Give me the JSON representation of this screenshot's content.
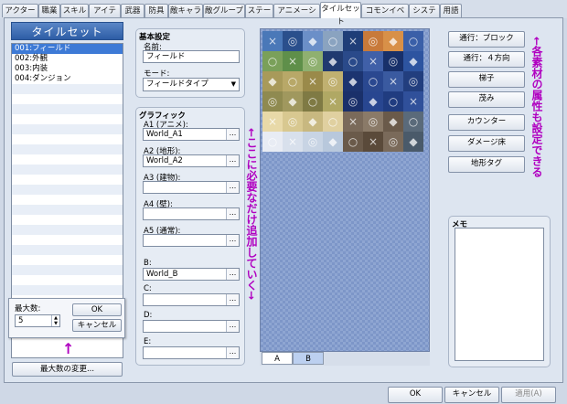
{
  "tabs": [
    "アクター",
    "職業",
    "スキル",
    "アイテム",
    "武器",
    "防具",
    "敵キャラ",
    "敵グループ",
    "ステート",
    "アニメーション",
    "タイルセット",
    "コモンイベント",
    "システム",
    "用語"
  ],
  "active_tab": "タイルセット",
  "tileset_panel": {
    "title": "タイルセット",
    "items": [
      "001:フィールド",
      "002:外観",
      "003:内装",
      "004:ダンジョン"
    ],
    "change_max_button": "最大数の変更..."
  },
  "max_popup": {
    "label": "最大数:",
    "value": "5",
    "ok": "OK",
    "cancel": "キャンセル"
  },
  "basic": {
    "group_label": "基本設定",
    "name_label": "名前:",
    "name_value": "フィールド",
    "mode_label": "モード:",
    "mode_value": "フィールドタイプ"
  },
  "graphics": {
    "group_label": "グラフィック",
    "slots": [
      {
        "label": "A1 (アニメ):",
        "value": "World_A1"
      },
      {
        "label": "A2 (地形):",
        "value": "World_A2"
      },
      {
        "label": "A3 (建物):",
        "value": ""
      },
      {
        "label": "A4 (壁):",
        "value": ""
      },
      {
        "label": "A5 (通常):",
        "value": ""
      },
      {
        "label": "B:",
        "value": "World_B"
      },
      {
        "label": "C:",
        "value": ""
      },
      {
        "label": "D:",
        "value": ""
      },
      {
        "label": "E:",
        "value": ""
      }
    ],
    "browse": "..."
  },
  "tile_tabs": [
    "A",
    "B"
  ],
  "right_buttons": [
    "通行：ブロック",
    "通行：４方向",
    "梯子",
    "茂み",
    "カウンター",
    "ダメージ床",
    "地形タグ"
  ],
  "memo_label": "メモ",
  "annotations": {
    "center": "←ここに必要なだけ追加していく→",
    "right": "←各素材の属性も設定できる",
    "arrow": "↑"
  },
  "bottom_buttons": {
    "ok": "OK",
    "cancel": "キャンセル",
    "apply": "適用(A)"
  },
  "colors": {
    "annotation": "#b000c0",
    "selection": "#3d7ad6",
    "header": "#2d5da6"
  }
}
